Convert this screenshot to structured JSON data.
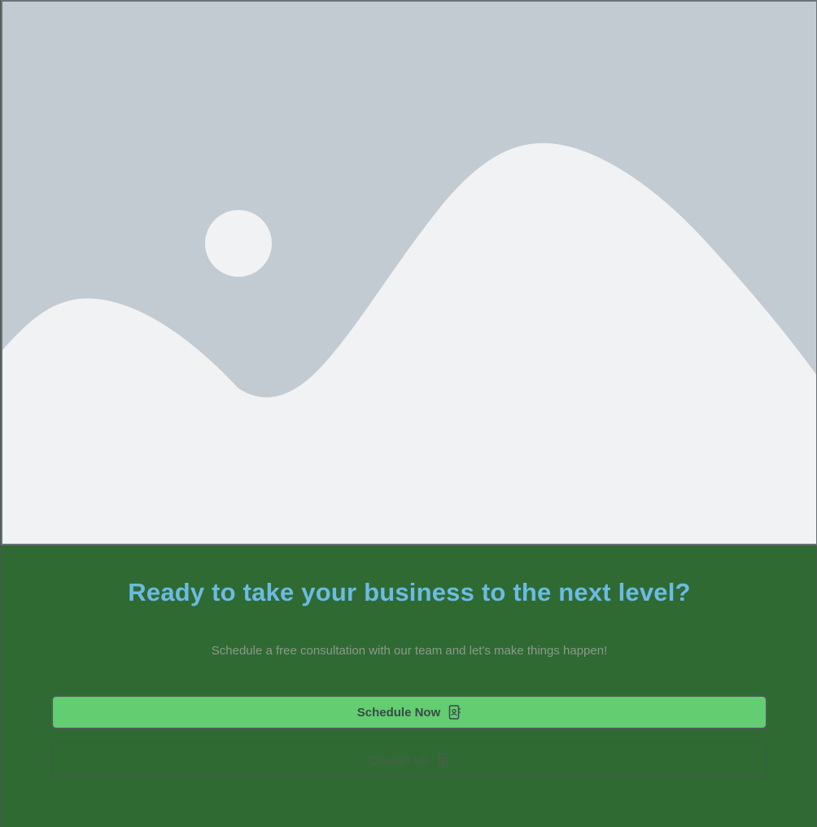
{
  "hero": {
    "image_icon": "image-placeholder-icon"
  },
  "cta": {
    "title": "Ready to take your business to the next level?",
    "subtitle": "Schedule a free consultation with our team and let's make things happen!",
    "primary_button": {
      "label": "Schedule Now",
      "icon": "contact-book-icon"
    },
    "secondary_button": {
      "label": "Contact Us",
      "icon": "contact-book-icon"
    }
  },
  "colors": {
    "section_bg": "#2f6a33",
    "title": "#6bbbe3",
    "primary_button_bg": "#62cd71",
    "placeholder_bg": "#c3cbd2",
    "placeholder_fg": "#f1f2f3"
  }
}
